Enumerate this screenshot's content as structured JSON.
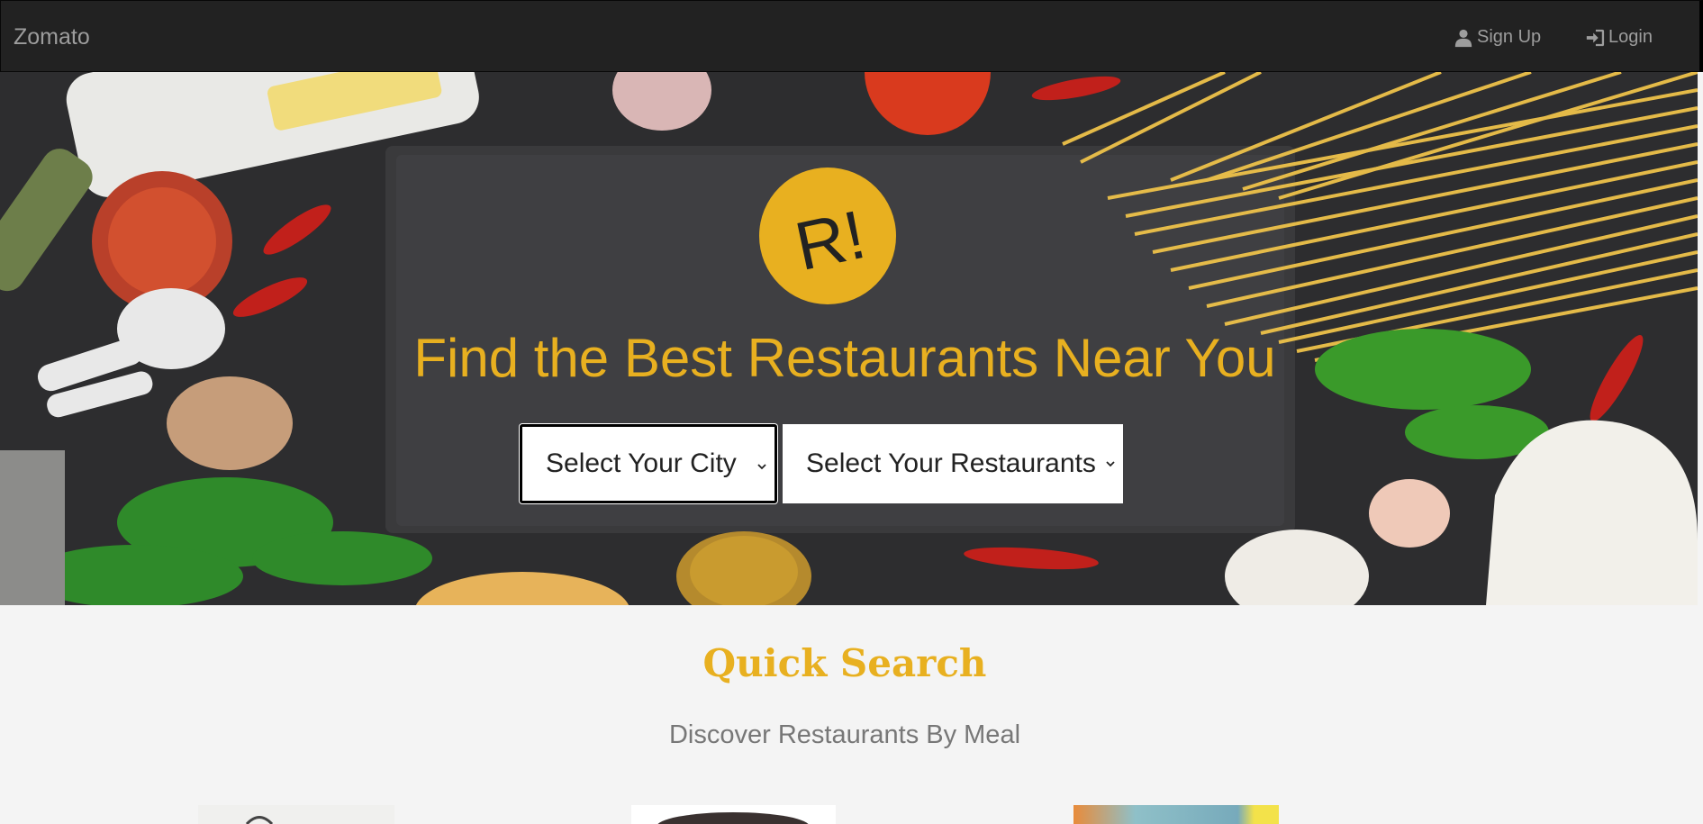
{
  "navbar": {
    "brand": "Zomato",
    "signup_label": "Sign Up",
    "login_label": "Login"
  },
  "hero": {
    "logo_text": "R!",
    "title": "Find the Best Restaurants Near You",
    "city_select": {
      "value": "Select Your City"
    },
    "restaurant_select": {
      "value": "Select Your Restaurants"
    }
  },
  "quick_search": {
    "title": "Quick Search",
    "subtitle": "Discover Restaurants By Meal"
  },
  "colors": {
    "accent": "#e8b020",
    "navbar_bg": "#222222",
    "nav_text": "#9d9d9d",
    "page_bg": "#f4f4f4"
  }
}
